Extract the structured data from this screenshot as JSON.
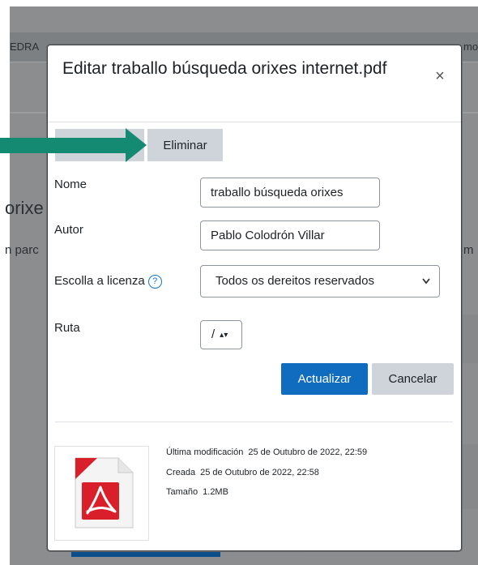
{
  "background": {
    "tab_fragment_left": "EDRA",
    "tab_fragment_right": "mo",
    "heading_fragment": "orixe",
    "text_fragment_left": "n parc",
    "text_fragment_right": "m"
  },
  "modal": {
    "title": "Editar traballo búsqueda orixes internet.pdf",
    "close_glyph": "×",
    "delete_label": "Eliminar",
    "fields": {
      "name_label": "Nome",
      "name_value": "traballo búsqueda orixes",
      "author_label": "Autor",
      "author_value": "Pablo Colodrón Villar",
      "license_label": "Escolla a licenza",
      "license_help_glyph": "?",
      "license_value": "Todos os dereitos reservados",
      "path_label": "Ruta",
      "path_value": "/"
    },
    "update_label": "Actualizar",
    "cancel_label": "Cancelar",
    "file_info": {
      "modified_label": "Última modificación",
      "modified_value": "25 de Outubro de 2022, 22:59",
      "created_label": "Creada",
      "created_value": "25 de Outubro de 2022, 22:58",
      "size_label": "Tamaño",
      "size_value": "1.2MB"
    }
  },
  "colors": {
    "primary": "#0f6cbf",
    "secondary": "#ced4da",
    "annotation_arrow": "#148a73",
    "pdf_red": "#d9202a"
  },
  "icons": {
    "close": "close-icon",
    "help": "help-icon",
    "file": "pdf-file-icon",
    "arrow": "annotation-arrow-icon"
  }
}
